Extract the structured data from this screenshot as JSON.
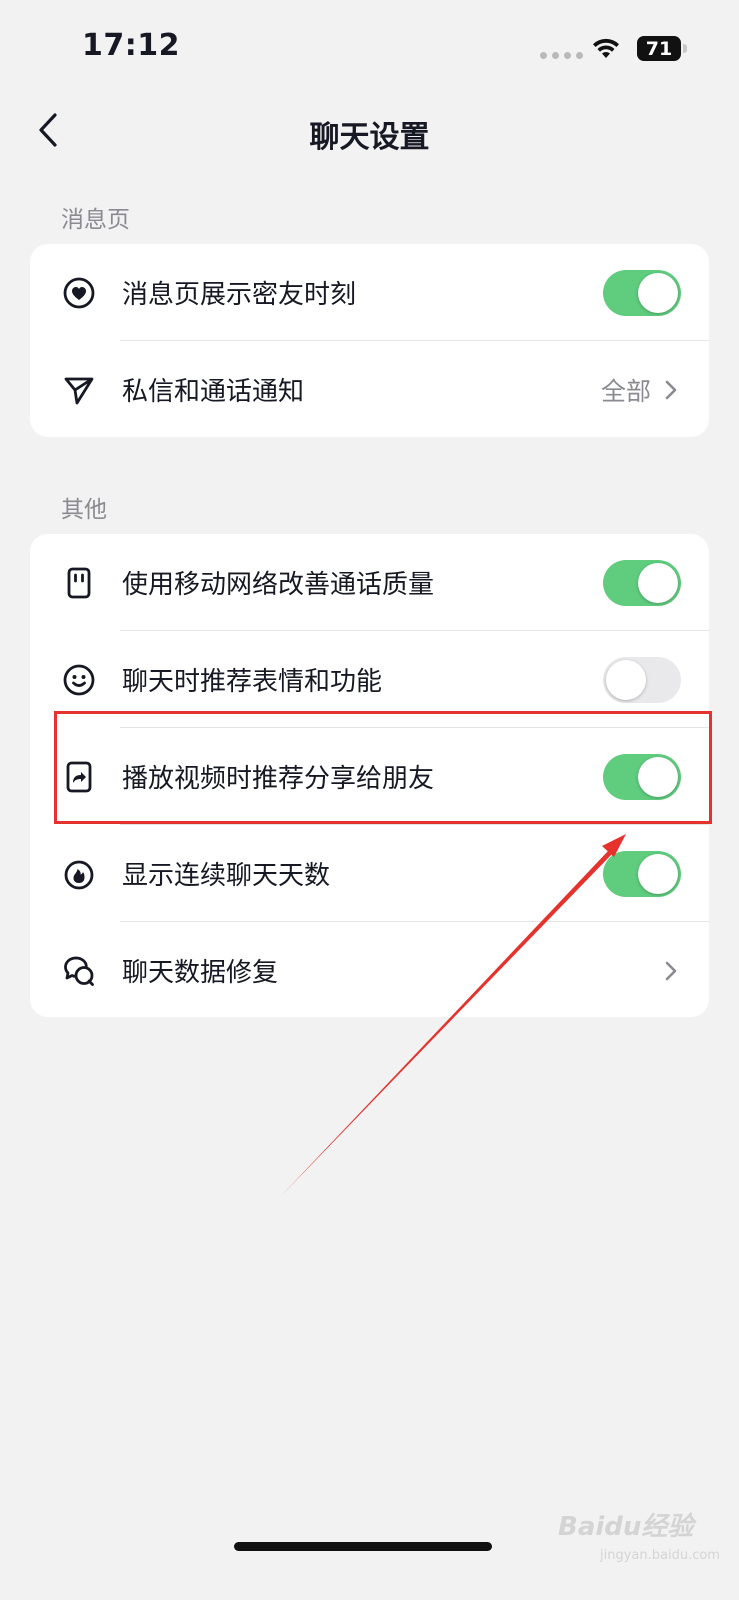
{
  "status_bar": {
    "time": "17:12",
    "battery": "71"
  },
  "nav": {
    "title": "聊天设置"
  },
  "sections": [
    {
      "header": "消息页",
      "rows": [
        {
          "label": "消息页展示密友时刻",
          "icon": "heart-circle-icon",
          "control": "toggle",
          "on": true
        },
        {
          "label": "私信和通话通知",
          "icon": "paper-plane-icon",
          "control": "link",
          "value": "全部"
        }
      ]
    },
    {
      "header": "其他",
      "rows": [
        {
          "label": "使用移动网络改善通话质量",
          "icon": "sim-card-icon",
          "control": "toggle",
          "on": true
        },
        {
          "label": "聊天时推荐表情和功能",
          "icon": "smiley-icon",
          "control": "toggle",
          "on": false
        },
        {
          "label": "播放视频时推荐分享给朋友",
          "icon": "share-video-icon",
          "control": "toggle",
          "on": true
        },
        {
          "label": "显示连续聊天天数",
          "icon": "flame-icon",
          "control": "toggle",
          "on": true
        },
        {
          "label": "聊天数据修复",
          "icon": "chat-bubbles-icon",
          "control": "link",
          "value": ""
        }
      ]
    }
  ],
  "watermark": {
    "text": "Baidu经验",
    "sub": "jingyan.baidu.com"
  },
  "colors": {
    "toggle_on": "#5fcc7e",
    "toggle_off": "#e9e9eb",
    "annotation": "#e5322d"
  }
}
